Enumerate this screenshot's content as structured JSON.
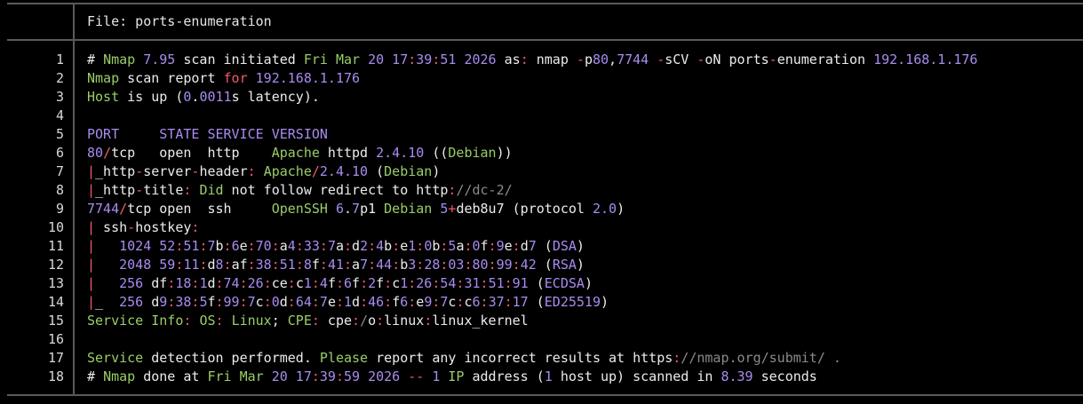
{
  "header": {
    "file_label": "File: ports-enumeration"
  },
  "gutter": [
    "1",
    "2",
    "3",
    "4",
    "5",
    "6",
    "7",
    "8",
    "9",
    "10",
    "11",
    "12",
    "13",
    "14",
    "15",
    "16",
    "17",
    "18"
  ],
  "lines": [
    [
      [
        "w",
        "# "
      ],
      [
        "g",
        "Nmap "
      ],
      [
        "p",
        "7.95"
      ],
      [
        "w",
        " scan initiated "
      ],
      [
        "g",
        "Fri Mar "
      ],
      [
        "p",
        "20 17"
      ],
      [
        "r",
        ":"
      ],
      [
        "p",
        "39"
      ],
      [
        "r",
        ":"
      ],
      [
        "p",
        "51 2026"
      ],
      [
        "w",
        " as"
      ],
      [
        "r",
        ":"
      ],
      [
        "w",
        " nmap "
      ],
      [
        "r",
        "-"
      ],
      [
        "w",
        "p"
      ],
      [
        "p",
        "80"
      ],
      [
        "w",
        ","
      ],
      [
        "p",
        "7744"
      ],
      [
        "w",
        " "
      ],
      [
        "r",
        "-"
      ],
      [
        "w",
        "sCV "
      ],
      [
        "r",
        "-"
      ],
      [
        "w",
        "oN ports"
      ],
      [
        "r",
        "-"
      ],
      [
        "w",
        "enumeration "
      ],
      [
        "p",
        "192.168.1.176"
      ]
    ],
    [
      [
        "g",
        "Nmap"
      ],
      [
        "w",
        " scan report "
      ],
      [
        "r",
        "for"
      ],
      [
        "w",
        " "
      ],
      [
        "p",
        "192.168.1.176"
      ]
    ],
    [
      [
        "g",
        "Host"
      ],
      [
        "w",
        " is up ("
      ],
      [
        "p",
        "0"
      ],
      [
        "w",
        "."
      ],
      [
        "p",
        "0011"
      ],
      [
        "w",
        "s latency)."
      ]
    ],
    [],
    [
      [
        "p",
        "PORT     STATE SERVICE VERSION"
      ]
    ],
    [
      [
        "p",
        "80"
      ],
      [
        "r",
        "/"
      ],
      [
        "w",
        "tcp   open  http    "
      ],
      [
        "g",
        "Apache"
      ],
      [
        "w",
        " httpd "
      ],
      [
        "p",
        "2.4.10"
      ],
      [
        "w",
        " (("
      ],
      [
        "g",
        "Debian"
      ],
      [
        "w",
        "))"
      ]
    ],
    [
      [
        "r",
        "|"
      ],
      [
        "w",
        "_http"
      ],
      [
        "r",
        "-"
      ],
      [
        "w",
        "server"
      ],
      [
        "r",
        "-"
      ],
      [
        "w",
        "header"
      ],
      [
        "r",
        ":"
      ],
      [
        "w",
        " "
      ],
      [
        "g",
        "Apache"
      ],
      [
        "r",
        "/"
      ],
      [
        "p",
        "2.4.10"
      ],
      [
        "w",
        " ("
      ],
      [
        "g",
        "Debian"
      ],
      [
        "w",
        ")"
      ]
    ],
    [
      [
        "r",
        "|"
      ],
      [
        "w",
        "_http"
      ],
      [
        "r",
        "-"
      ],
      [
        "w",
        "title"
      ],
      [
        "r",
        ":"
      ],
      [
        "w",
        " "
      ],
      [
        "g",
        "Did"
      ],
      [
        "w",
        " not follow redirect to http"
      ],
      [
        "r",
        ":"
      ],
      [
        "gr",
        "//dc-2/"
      ]
    ],
    [
      [
        "p",
        "7744"
      ],
      [
        "r",
        "/"
      ],
      [
        "w",
        "tcp open  ssh     "
      ],
      [
        "g",
        "OpenSSH"
      ],
      [
        "w",
        " "
      ],
      [
        "p",
        "6"
      ],
      [
        "w",
        "."
      ],
      [
        "p",
        "7"
      ],
      [
        "w",
        "p1 "
      ],
      [
        "g",
        "Debian"
      ],
      [
        "w",
        " "
      ],
      [
        "p",
        "5"
      ],
      [
        "r",
        "+"
      ],
      [
        "w",
        "deb8u7 (protocol "
      ],
      [
        "p",
        "2.0"
      ],
      [
        "w",
        ")"
      ]
    ],
    [
      [
        "r",
        "|"
      ],
      [
        "w",
        " ssh"
      ],
      [
        "r",
        "-"
      ],
      [
        "w",
        "hostkey"
      ],
      [
        "r",
        ":"
      ]
    ],
    [
      [
        "r",
        "|"
      ],
      [
        "w",
        "   "
      ],
      [
        "p",
        "1024 52"
      ],
      [
        "r",
        ":"
      ],
      [
        "p",
        "51"
      ],
      [
        "r",
        ":"
      ],
      [
        "p",
        "7"
      ],
      [
        "w",
        "b"
      ],
      [
        "r",
        ":"
      ],
      [
        "p",
        "6"
      ],
      [
        "w",
        "e"
      ],
      [
        "r",
        ":"
      ],
      [
        "p",
        "70"
      ],
      [
        "r",
        ":"
      ],
      [
        "w",
        "a"
      ],
      [
        "p",
        "4"
      ],
      [
        "r",
        ":"
      ],
      [
        "p",
        "33"
      ],
      [
        "r",
        ":"
      ],
      [
        "p",
        "7"
      ],
      [
        "w",
        "a"
      ],
      [
        "r",
        ":"
      ],
      [
        "w",
        "d"
      ],
      [
        "p",
        "2"
      ],
      [
        "r",
        ":"
      ],
      [
        "p",
        "4"
      ],
      [
        "w",
        "b"
      ],
      [
        "r",
        ":"
      ],
      [
        "w",
        "e"
      ],
      [
        "p",
        "1"
      ],
      [
        "r",
        ":"
      ],
      [
        "p",
        "0"
      ],
      [
        "w",
        "b"
      ],
      [
        "r",
        ":"
      ],
      [
        "p",
        "5"
      ],
      [
        "w",
        "a"
      ],
      [
        "r",
        ":"
      ],
      [
        "p",
        "0"
      ],
      [
        "w",
        "f"
      ],
      [
        "r",
        ":"
      ],
      [
        "p",
        "9"
      ],
      [
        "w",
        "e"
      ],
      [
        "r",
        ":"
      ],
      [
        "w",
        "d"
      ],
      [
        "p",
        "7"
      ],
      [
        "w",
        " ("
      ],
      [
        "p",
        "DSA"
      ],
      [
        "w",
        ")"
      ]
    ],
    [
      [
        "r",
        "|"
      ],
      [
        "w",
        "   "
      ],
      [
        "p",
        "2048 59"
      ],
      [
        "r",
        ":"
      ],
      [
        "p",
        "11"
      ],
      [
        "r",
        ":"
      ],
      [
        "w",
        "d"
      ],
      [
        "p",
        "8"
      ],
      [
        "r",
        ":"
      ],
      [
        "w",
        "af"
      ],
      [
        "r",
        ":"
      ],
      [
        "p",
        "38"
      ],
      [
        "r",
        ":"
      ],
      [
        "p",
        "51"
      ],
      [
        "r",
        ":"
      ],
      [
        "p",
        "8"
      ],
      [
        "w",
        "f"
      ],
      [
        "r",
        ":"
      ],
      [
        "p",
        "41"
      ],
      [
        "r",
        ":"
      ],
      [
        "w",
        "a"
      ],
      [
        "p",
        "7"
      ],
      [
        "r",
        ":"
      ],
      [
        "p",
        "44"
      ],
      [
        "r",
        ":"
      ],
      [
        "w",
        "b"
      ],
      [
        "p",
        "3"
      ],
      [
        "r",
        ":"
      ],
      [
        "p",
        "28"
      ],
      [
        "r",
        ":"
      ],
      [
        "p",
        "03"
      ],
      [
        "r",
        ":"
      ],
      [
        "p",
        "80"
      ],
      [
        "r",
        ":"
      ],
      [
        "p",
        "99"
      ],
      [
        "r",
        ":"
      ],
      [
        "p",
        "42"
      ],
      [
        "w",
        " ("
      ],
      [
        "p",
        "RSA"
      ],
      [
        "w",
        ")"
      ]
    ],
    [
      [
        "r",
        "|"
      ],
      [
        "w",
        "   "
      ],
      [
        "p",
        "256"
      ],
      [
        "w",
        " df"
      ],
      [
        "r",
        ":"
      ],
      [
        "p",
        "18"
      ],
      [
        "r",
        ":"
      ],
      [
        "p",
        "1"
      ],
      [
        "w",
        "d"
      ],
      [
        "r",
        ":"
      ],
      [
        "p",
        "74"
      ],
      [
        "r",
        ":"
      ],
      [
        "p",
        "26"
      ],
      [
        "r",
        ":"
      ],
      [
        "w",
        "ce"
      ],
      [
        "r",
        ":"
      ],
      [
        "w",
        "c"
      ],
      [
        "p",
        "1"
      ],
      [
        "r",
        ":"
      ],
      [
        "p",
        "4"
      ],
      [
        "w",
        "f"
      ],
      [
        "r",
        ":"
      ],
      [
        "p",
        "6"
      ],
      [
        "w",
        "f"
      ],
      [
        "r",
        ":"
      ],
      [
        "p",
        "2"
      ],
      [
        "w",
        "f"
      ],
      [
        "r",
        ":"
      ],
      [
        "w",
        "c"
      ],
      [
        "p",
        "1"
      ],
      [
        "r",
        ":"
      ],
      [
        "p",
        "26"
      ],
      [
        "r",
        ":"
      ],
      [
        "p",
        "54"
      ],
      [
        "r",
        ":"
      ],
      [
        "p",
        "31"
      ],
      [
        "r",
        ":"
      ],
      [
        "p",
        "51"
      ],
      [
        "r",
        ":"
      ],
      [
        "p",
        "91"
      ],
      [
        "w",
        " ("
      ],
      [
        "p",
        "ECDSA"
      ],
      [
        "w",
        ")"
      ]
    ],
    [
      [
        "r",
        "|"
      ],
      [
        "w",
        "_  "
      ],
      [
        "p",
        "256"
      ],
      [
        "w",
        " d"
      ],
      [
        "p",
        "9"
      ],
      [
        "r",
        ":"
      ],
      [
        "p",
        "38"
      ],
      [
        "r",
        ":"
      ],
      [
        "p",
        "5"
      ],
      [
        "w",
        "f"
      ],
      [
        "r",
        ":"
      ],
      [
        "p",
        "99"
      ],
      [
        "r",
        ":"
      ],
      [
        "p",
        "7"
      ],
      [
        "w",
        "c"
      ],
      [
        "r",
        ":"
      ],
      [
        "p",
        "0"
      ],
      [
        "w",
        "d"
      ],
      [
        "r",
        ":"
      ],
      [
        "p",
        "64"
      ],
      [
        "r",
        ":"
      ],
      [
        "p",
        "7"
      ],
      [
        "w",
        "e"
      ],
      [
        "r",
        ":"
      ],
      [
        "p",
        "1"
      ],
      [
        "w",
        "d"
      ],
      [
        "r",
        ":"
      ],
      [
        "p",
        "46"
      ],
      [
        "r",
        ":"
      ],
      [
        "w",
        "f"
      ],
      [
        "p",
        "6"
      ],
      [
        "r",
        ":"
      ],
      [
        "w",
        "e"
      ],
      [
        "p",
        "9"
      ],
      [
        "r",
        ":"
      ],
      [
        "p",
        "7"
      ],
      [
        "w",
        "c"
      ],
      [
        "r",
        ":"
      ],
      [
        "w",
        "c"
      ],
      [
        "p",
        "6"
      ],
      [
        "r",
        ":"
      ],
      [
        "p",
        "37"
      ],
      [
        "r",
        ":"
      ],
      [
        "p",
        "17"
      ],
      [
        "w",
        " ("
      ],
      [
        "p",
        "ED25519"
      ],
      [
        "w",
        ")"
      ]
    ],
    [
      [
        "g",
        "Service Info"
      ],
      [
        "r",
        ":"
      ],
      [
        "w",
        " "
      ],
      [
        "g",
        "OS"
      ],
      [
        "r",
        ":"
      ],
      [
        "w",
        " "
      ],
      [
        "g",
        "Linux"
      ],
      [
        "w",
        "; "
      ],
      [
        "g",
        "CPE"
      ],
      [
        "r",
        ":"
      ],
      [
        "w",
        " cpe"
      ],
      [
        "r",
        ":"
      ],
      [
        "gr",
        "/"
      ],
      [
        "w",
        "o"
      ],
      [
        "r",
        ":"
      ],
      [
        "w",
        "linux"
      ],
      [
        "r",
        ":"
      ],
      [
        "w",
        "linux_kernel"
      ]
    ],
    [],
    [
      [
        "g",
        "Service"
      ],
      [
        "w",
        " detection performed. "
      ],
      [
        "g",
        "Please"
      ],
      [
        "w",
        " report any incorrect results at https"
      ],
      [
        "r",
        ":"
      ],
      [
        "gr",
        "//nmap.org/submit/ ."
      ]
    ],
    [
      [
        "w",
        "# "
      ],
      [
        "g",
        "Nmap"
      ],
      [
        "w",
        " done at "
      ],
      [
        "g",
        "Fri Mar "
      ],
      [
        "p",
        "20 17"
      ],
      [
        "r",
        ":"
      ],
      [
        "p",
        "39"
      ],
      [
        "r",
        ":"
      ],
      [
        "p",
        "59 2026"
      ],
      [
        "w",
        " "
      ],
      [
        "r",
        "--"
      ],
      [
        "w",
        " "
      ],
      [
        "p",
        "1"
      ],
      [
        "w",
        " "
      ],
      [
        "g",
        "IP"
      ],
      [
        "w",
        " address ("
      ],
      [
        "p",
        "1"
      ],
      [
        "w",
        " host up) scanned in "
      ],
      [
        "p",
        "8.39"
      ],
      [
        "w",
        " seconds"
      ]
    ]
  ]
}
